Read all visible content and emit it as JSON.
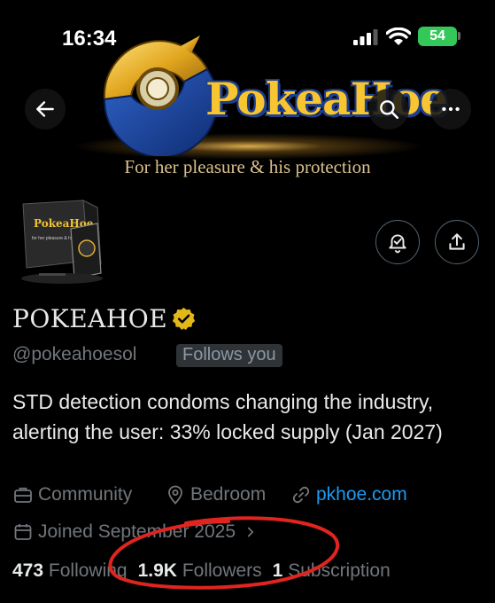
{
  "status_bar": {
    "time": "16:34",
    "battery": "54"
  },
  "banner": {
    "logo_text": "PokeaHoe",
    "tagline": "For her pleasure & his protection"
  },
  "avatar": {
    "box_brand": "PokeaHoe",
    "box_tagline": "for her pleasure & his protection"
  },
  "profile": {
    "name": "POKEAHOE",
    "handle": "@pokeahoesol",
    "follows_you": "Follows you",
    "bio": "STD detection condoms changing the industry, alerting the user: 33% locked supply (Jan 2027)",
    "community": "Community",
    "location": "Bedroom",
    "link": "pkhoe.com",
    "joined": "Joined September 2025",
    "following_count": "473",
    "following_label": "Following",
    "followers_count": "1.9K",
    "followers_label": "Followers",
    "subscriptions_count": "1",
    "subscriptions_label": "Subscription"
  },
  "colors": {
    "accent_link": "#1d9bf0",
    "verified_badge": "#e2b719",
    "annotation_circle": "#e0241f",
    "battery": "#34c759"
  },
  "icons": [
    "back-arrow-icon",
    "search-icon",
    "more-dots-icon",
    "notification-bell-icon",
    "share-icon",
    "verified-badge-icon",
    "community-icon",
    "location-pin-icon",
    "link-icon",
    "calendar-icon",
    "chevron-right-icon"
  ]
}
